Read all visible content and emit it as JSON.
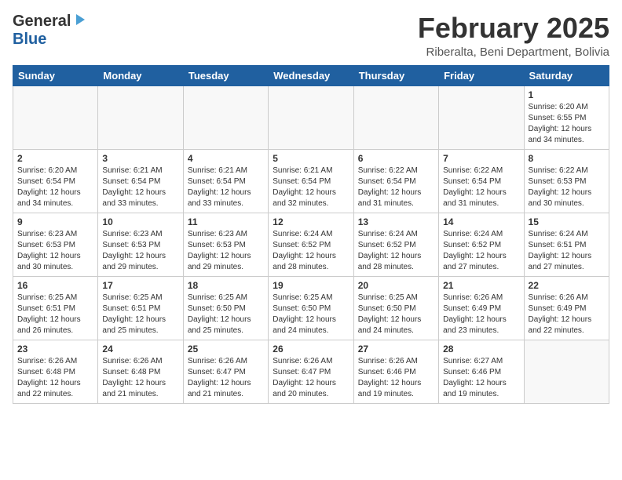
{
  "header": {
    "logo_general": "General",
    "logo_blue": "Blue",
    "month": "February 2025",
    "location": "Riberalta, Beni Department, Bolivia"
  },
  "weekdays": [
    "Sunday",
    "Monday",
    "Tuesday",
    "Wednesday",
    "Thursday",
    "Friday",
    "Saturday"
  ],
  "weeks": [
    [
      {
        "num": "",
        "info": ""
      },
      {
        "num": "",
        "info": ""
      },
      {
        "num": "",
        "info": ""
      },
      {
        "num": "",
        "info": ""
      },
      {
        "num": "",
        "info": ""
      },
      {
        "num": "",
        "info": ""
      },
      {
        "num": "1",
        "info": "Sunrise: 6:20 AM\nSunset: 6:55 PM\nDaylight: 12 hours and 34 minutes."
      }
    ],
    [
      {
        "num": "2",
        "info": "Sunrise: 6:20 AM\nSunset: 6:54 PM\nDaylight: 12 hours and 34 minutes."
      },
      {
        "num": "3",
        "info": "Sunrise: 6:21 AM\nSunset: 6:54 PM\nDaylight: 12 hours and 33 minutes."
      },
      {
        "num": "4",
        "info": "Sunrise: 6:21 AM\nSunset: 6:54 PM\nDaylight: 12 hours and 33 minutes."
      },
      {
        "num": "5",
        "info": "Sunrise: 6:21 AM\nSunset: 6:54 PM\nDaylight: 12 hours and 32 minutes."
      },
      {
        "num": "6",
        "info": "Sunrise: 6:22 AM\nSunset: 6:54 PM\nDaylight: 12 hours and 31 minutes."
      },
      {
        "num": "7",
        "info": "Sunrise: 6:22 AM\nSunset: 6:54 PM\nDaylight: 12 hours and 31 minutes."
      },
      {
        "num": "8",
        "info": "Sunrise: 6:22 AM\nSunset: 6:53 PM\nDaylight: 12 hours and 30 minutes."
      }
    ],
    [
      {
        "num": "9",
        "info": "Sunrise: 6:23 AM\nSunset: 6:53 PM\nDaylight: 12 hours and 30 minutes."
      },
      {
        "num": "10",
        "info": "Sunrise: 6:23 AM\nSunset: 6:53 PM\nDaylight: 12 hours and 29 minutes."
      },
      {
        "num": "11",
        "info": "Sunrise: 6:23 AM\nSunset: 6:53 PM\nDaylight: 12 hours and 29 minutes."
      },
      {
        "num": "12",
        "info": "Sunrise: 6:24 AM\nSunset: 6:52 PM\nDaylight: 12 hours and 28 minutes."
      },
      {
        "num": "13",
        "info": "Sunrise: 6:24 AM\nSunset: 6:52 PM\nDaylight: 12 hours and 28 minutes."
      },
      {
        "num": "14",
        "info": "Sunrise: 6:24 AM\nSunset: 6:52 PM\nDaylight: 12 hours and 27 minutes."
      },
      {
        "num": "15",
        "info": "Sunrise: 6:24 AM\nSunset: 6:51 PM\nDaylight: 12 hours and 27 minutes."
      }
    ],
    [
      {
        "num": "16",
        "info": "Sunrise: 6:25 AM\nSunset: 6:51 PM\nDaylight: 12 hours and 26 minutes."
      },
      {
        "num": "17",
        "info": "Sunrise: 6:25 AM\nSunset: 6:51 PM\nDaylight: 12 hours and 25 minutes."
      },
      {
        "num": "18",
        "info": "Sunrise: 6:25 AM\nSunset: 6:50 PM\nDaylight: 12 hours and 25 minutes."
      },
      {
        "num": "19",
        "info": "Sunrise: 6:25 AM\nSunset: 6:50 PM\nDaylight: 12 hours and 24 minutes."
      },
      {
        "num": "20",
        "info": "Sunrise: 6:25 AM\nSunset: 6:50 PM\nDaylight: 12 hours and 24 minutes."
      },
      {
        "num": "21",
        "info": "Sunrise: 6:26 AM\nSunset: 6:49 PM\nDaylight: 12 hours and 23 minutes."
      },
      {
        "num": "22",
        "info": "Sunrise: 6:26 AM\nSunset: 6:49 PM\nDaylight: 12 hours and 22 minutes."
      }
    ],
    [
      {
        "num": "23",
        "info": "Sunrise: 6:26 AM\nSunset: 6:48 PM\nDaylight: 12 hours and 22 minutes."
      },
      {
        "num": "24",
        "info": "Sunrise: 6:26 AM\nSunset: 6:48 PM\nDaylight: 12 hours and 21 minutes."
      },
      {
        "num": "25",
        "info": "Sunrise: 6:26 AM\nSunset: 6:47 PM\nDaylight: 12 hours and 21 minutes."
      },
      {
        "num": "26",
        "info": "Sunrise: 6:26 AM\nSunset: 6:47 PM\nDaylight: 12 hours and 20 minutes."
      },
      {
        "num": "27",
        "info": "Sunrise: 6:26 AM\nSunset: 6:46 PM\nDaylight: 12 hours and 19 minutes."
      },
      {
        "num": "28",
        "info": "Sunrise: 6:27 AM\nSunset: 6:46 PM\nDaylight: 12 hours and 19 minutes."
      },
      {
        "num": "",
        "info": ""
      }
    ]
  ]
}
